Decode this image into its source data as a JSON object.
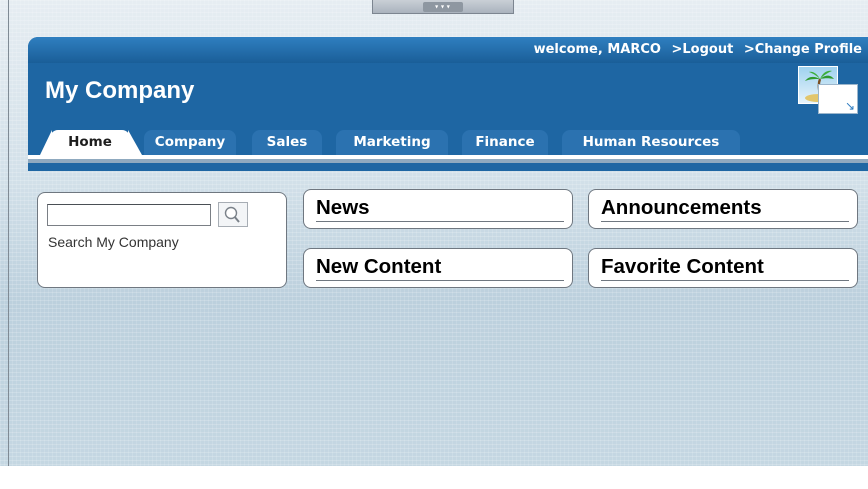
{
  "header": {
    "welcome_text": "welcome, MARCO",
    "logout_link": ">Logout",
    "change_profile_link": ">Change Profile",
    "company_name": "My Company"
  },
  "tabs": [
    {
      "label": "Home",
      "active": true
    },
    {
      "label": "Company",
      "active": false
    },
    {
      "label": "Sales",
      "active": false
    },
    {
      "label": "Marketing",
      "active": false
    },
    {
      "label": "Finance",
      "active": false
    },
    {
      "label": "Human Resources",
      "active": false
    }
  ],
  "search": {
    "value": "",
    "label": "Search My Company",
    "button_icon": "magnifier-icon"
  },
  "portlets": {
    "news": "News",
    "announcements": "Announcements",
    "new_content": "New Content",
    "favorite_content": "Favorite Content"
  },
  "colors": {
    "banner": "#1e66a3",
    "tab_inactive": "#2b72b0",
    "background": "#d2e0e9"
  }
}
